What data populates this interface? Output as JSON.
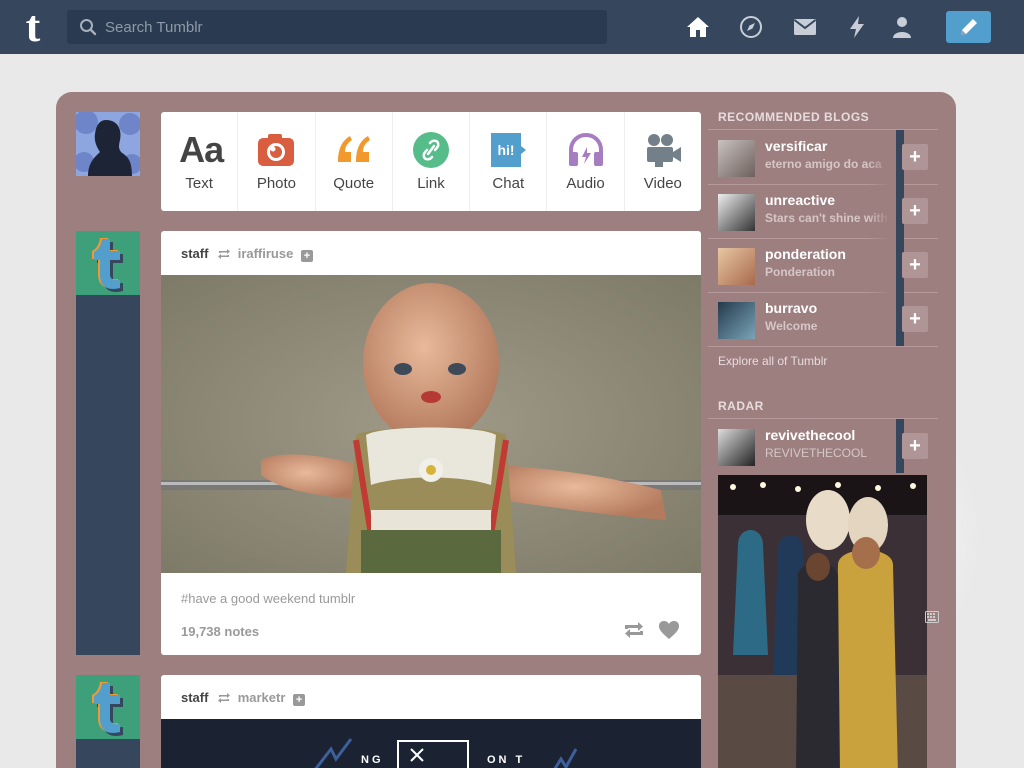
{
  "header": {
    "logo": "t",
    "search_placeholder": "Search Tumblr"
  },
  "composer": {
    "types": [
      {
        "label": "Text",
        "icon": "text-icon",
        "glyph": "Aa",
        "color": "#444444"
      },
      {
        "label": "Photo",
        "icon": "camera-icon",
        "color": "#d95e40"
      },
      {
        "label": "Quote",
        "icon": "quote-icon",
        "color": "#f2992e"
      },
      {
        "label": "Link",
        "icon": "link-icon",
        "color": "#56bc8a"
      },
      {
        "label": "Chat",
        "icon": "chat-icon",
        "glyph": "hi!",
        "color": "#529ecc"
      },
      {
        "label": "Audio",
        "icon": "headphones-icon",
        "color": "#a77dc2"
      },
      {
        "label": "Video",
        "icon": "video-camera-icon",
        "color": "#748089"
      }
    ]
  },
  "posts": [
    {
      "author": "staff",
      "reblogged_from": "iraffiruse",
      "tags": "#have a good weekend tumblr",
      "notes": "19,738 notes"
    },
    {
      "author": "staff",
      "reblogged_from": "marketr",
      "image_text_left": "NG",
      "image_text_right": "ON T"
    }
  ],
  "sidebar": {
    "recommended_title": "RECOMMENDED BLOGS",
    "blogs": [
      {
        "name": "versificar",
        "desc": "eterno amigo do aca"
      },
      {
        "name": "unreactive",
        "desc": "Stars can't shine with"
      },
      {
        "name": "ponderation",
        "desc": "Ponderation"
      },
      {
        "name": "burravo",
        "desc": "Welcome"
      }
    ],
    "explore": "Explore all of Tumblr",
    "radar_title": "RADAR",
    "radar_blog": {
      "name": "revivethecool",
      "desc": "REVIVETHECOOL"
    }
  },
  "colors": {
    "navbar": "#36465d",
    "panel": "#9d7f80",
    "compose": "#529ecc"
  }
}
